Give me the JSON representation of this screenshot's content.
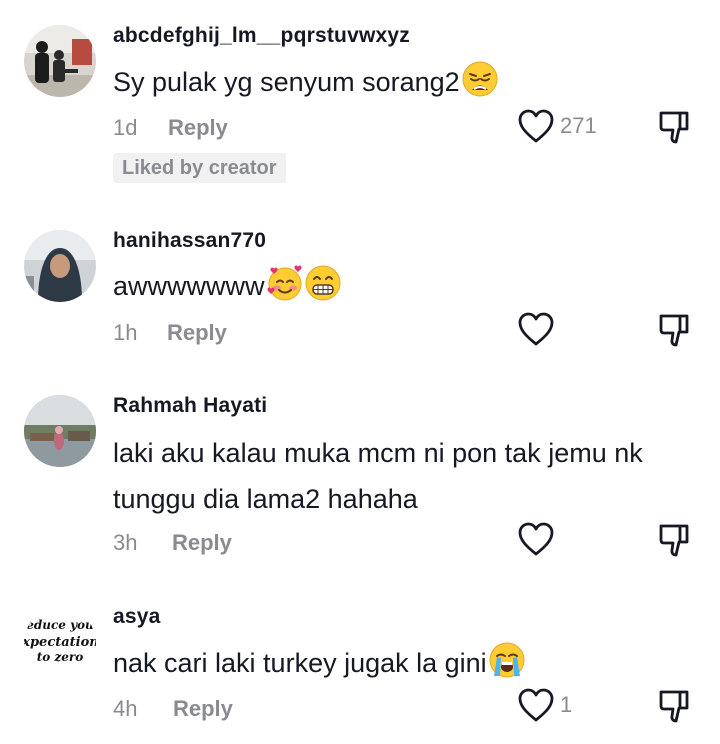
{
  "comments": [
    {
      "username": "abcdefghij_lm__pqrstuvwxyz",
      "text": "Sy pulak yg senyum sorang2",
      "emoji": "weary-face-icon",
      "time": "1d",
      "reply_label": "Reply",
      "like_count": "271",
      "badge": "Liked by creator"
    },
    {
      "username": "hanihassan770",
      "text": "awwwwwww",
      "emoji": [
        "smiling-face-with-hearts-icon",
        "beaming-face-icon"
      ],
      "time": "1h",
      "reply_label": "Reply"
    },
    {
      "username": "Rahmah Hayati",
      "text": "laki aku kalau muka mcm ni pon tak jemu nk tunggu dia lama2 hahaha",
      "time": "3h",
      "reply_label": "Reply"
    },
    {
      "username": "asya",
      "text": "nak cari laki turkey jugak la gini",
      "emoji": "loudly-crying-face-icon",
      "time": "4h",
      "reply_label": "Reply",
      "like_count": "1",
      "avatar_text": [
        "reduce your",
        "expectations",
        "to zero"
      ]
    }
  ],
  "colors": {
    "primary_text": "#161823",
    "secondary_text": "#8a8b91",
    "badge_bg": "#f1f1f2",
    "icon_stroke": "#161823"
  }
}
